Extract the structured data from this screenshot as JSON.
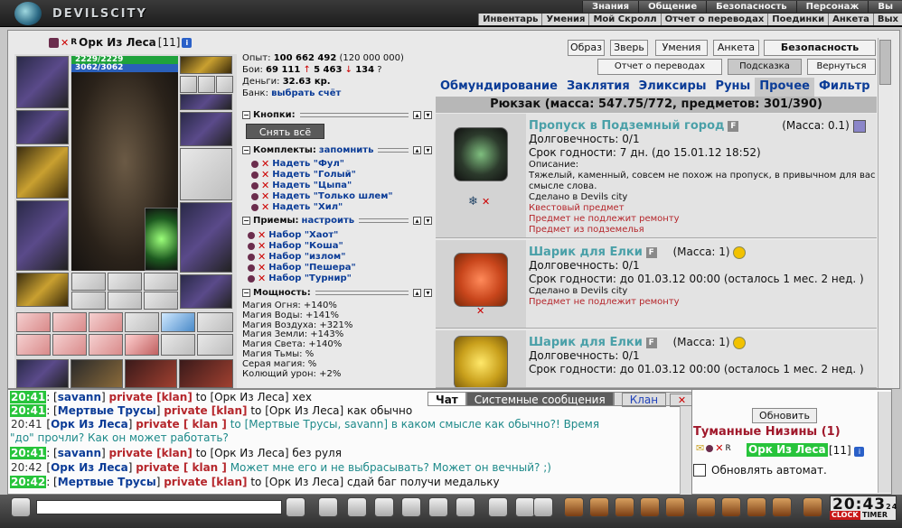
{
  "brand": "DEVILSCITY",
  "topnav": [
    "Знания",
    "Общение",
    "Безопасность",
    "Персонаж",
    "Вы"
  ],
  "subnav": [
    "Инвентарь",
    "Умения",
    "Мой Скролл",
    "Отчет о переводах",
    "Поединки",
    "Анкета",
    "Вых"
  ],
  "character": {
    "name": "Орк Из Леса",
    "level": "[11]",
    "hp": "2229/2229",
    "mp": "3062/3062"
  },
  "stats": {
    "exp_label": "Опыт:",
    "exp": "100 662 492",
    "exp_next": "(120 000 000)",
    "battles_label": "Бои:",
    "wins": "69 111",
    "losses": "5 463",
    "draws": "134",
    "money_label": "Деньги:",
    "money": "32.63 кр.",
    "bank_label": "Банк:",
    "bank_link": "выбрать счёт"
  },
  "buttons_section": {
    "title": "Кнопки:",
    "remove_all": "Снять всё"
  },
  "sets_section": {
    "title": "Комплекты:",
    "remember": "запомнить",
    "items": [
      "Надеть \"Фул\"",
      "Надеть \"Голый\"",
      "Надеть \"Цыпа\"",
      "Надеть \"Только шлем\"",
      "Надеть \"Хил\""
    ]
  },
  "moves_section": {
    "title": "Приемы:",
    "configure": "настроить",
    "items": [
      "Набор \"Хаот\"",
      "Набор \"Коша\"",
      "Набор \"излом\"",
      "Набор \"Пешера\"",
      "Набор \"Турнир\""
    ]
  },
  "power_section": {
    "title": "Мощность:",
    "items": [
      "Магия Огня: +140%",
      "Магия Воды: +141%",
      "Магия Воздуха: +321%",
      "Магия Земли: +143%",
      "Магия Света: +140%",
      "Магия Тьмы: %",
      "Серая магия: %",
      "Колющий урон: +2%"
    ]
  },
  "top_buttons": [
    "Образ",
    "Зверь",
    "Умения",
    "Анкета",
    "Безопасность"
  ],
  "second_buttons": [
    "Отчет о переводах",
    "Подсказка",
    "Вернуться"
  ],
  "inv_tabs": [
    "Обмундирование",
    "Заклятия",
    "Эликсиры",
    "Руны",
    "Прочее",
    "Фильтр"
  ],
  "backpack": "Рюкзак (масса: 547.75/772, предметов: 301/390)",
  "items": [
    {
      "name": "Пропуск в Подземный город",
      "mass": "(Масса: 0.1)",
      "durability": "Долговечность: 0/1",
      "expiry": "Срок годности: 7 дн. (до 15.01.12 18:52)",
      "desc_label": "Описание:",
      "desc": "Тяжелый, каменный, совсем не похож на пропуск, в привычном для вас смысле слова.",
      "made": "Сделано в Devils city",
      "notes": [
        "Квестовый предмет",
        "Предмет не подлежит ремонту",
        "Предмет из подземелья"
      ]
    },
    {
      "name": "Шарик для Елки",
      "mass": "(Масса: 1)",
      "durability": "Долговечность: 0/1",
      "expiry": "Срок годности: до 01.03.12 00:00 (осталось 1 мес. 2 нед. )",
      "made": "Сделано в Devils city",
      "notes": [
        "Предмет не подлежит ремонту"
      ]
    },
    {
      "name": "Шарик для Елки",
      "mass": "(Масса: 1)",
      "durability": "Долговечность: 0/1",
      "expiry": "Срок годности: до 01.03.12 00:00 (осталось 1 мес. 2 нед. )"
    }
  ],
  "chat_tabs": [
    "Чат",
    "Системные сообщения",
    "Клан"
  ],
  "chat": [
    {
      "time": "20:41",
      "nick": "savann",
      "priv": "private [klan]",
      "to": "to [Орк Из Леса]",
      "msg": "хех",
      "hl": true
    },
    {
      "time": "20:41",
      "nick": "Мертвые Трусы",
      "priv": "private [klan]",
      "to": "to [Орк Из Леса]",
      "msg": "как обычно",
      "hl": true
    },
    {
      "time": "20:41",
      "nick": "Орк Из Леса",
      "priv": "private [ klan ]",
      "to": "to [Мертвые Трусы, savann]",
      "msg": "в каком смысле как обычно?! Время",
      "hl": false
    },
    {
      "cont": "\"до\" прочли? Как он может работать?"
    },
    {
      "time": "20:41",
      "nick": "savann",
      "priv": "private [klan]",
      "to": "to [Орк Из Леса]",
      "msg": "без руля",
      "hl": true
    },
    {
      "time": "20:42",
      "nick": "Орк Из Леса",
      "priv": "private [ klan ]",
      "to": "",
      "msg": "Может мне его и не выбрасывать? Может он вечный? ;)",
      "hl": false
    },
    {
      "time": "20:42",
      "nick": "Мертвые Трусы",
      "priv": "private [klan]",
      "to": "to [Орк Из Леса]",
      "msg": "сдай баг получи медальку",
      "hl": true
    }
  ],
  "online": {
    "refresh": "Обновить",
    "location": "Туманные Низины (1)",
    "user": "Орк Из Леса",
    "level": "[11]",
    "auto": "Обновлять автомат."
  },
  "clock": {
    "time": "20:43",
    "sec": "24",
    "clock_label": "CLOCK",
    "timer_label": "TIMER"
  }
}
